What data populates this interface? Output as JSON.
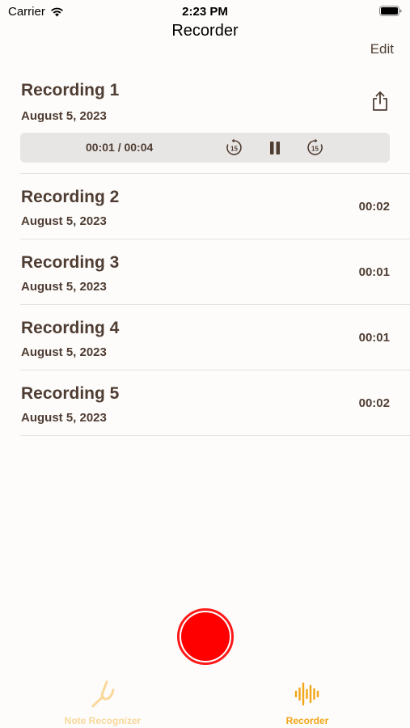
{
  "status_bar": {
    "carrier": "Carrier",
    "time": "2:23 PM"
  },
  "nav": {
    "title": "Recorder",
    "edit_label": "Edit"
  },
  "recordings": [
    {
      "title": "Recording 1",
      "date": "August 5, 2023",
      "expanded": true
    },
    {
      "title": "Recording 2",
      "date": "August 5, 2023",
      "duration": "00:02"
    },
    {
      "title": "Recording 3",
      "date": "August 5, 2023",
      "duration": "00:01"
    },
    {
      "title": "Recording 4",
      "date": "August 5, 2023",
      "duration": "00:01"
    },
    {
      "title": "Recording 5",
      "date": "August 5, 2023",
      "duration": "00:02"
    }
  ],
  "player": {
    "time": "00:01 / 00:04",
    "skip_seconds": "15"
  },
  "tabs": [
    {
      "label": "Note Recognizer",
      "icon": "tuning-fork-icon",
      "selected": false
    },
    {
      "label": "Recorder",
      "icon": "waveform-icon",
      "selected": true
    }
  ],
  "colors": {
    "accent": "#f2a516",
    "text_brown": "#4f3d33",
    "record_red": "#ff0000"
  }
}
